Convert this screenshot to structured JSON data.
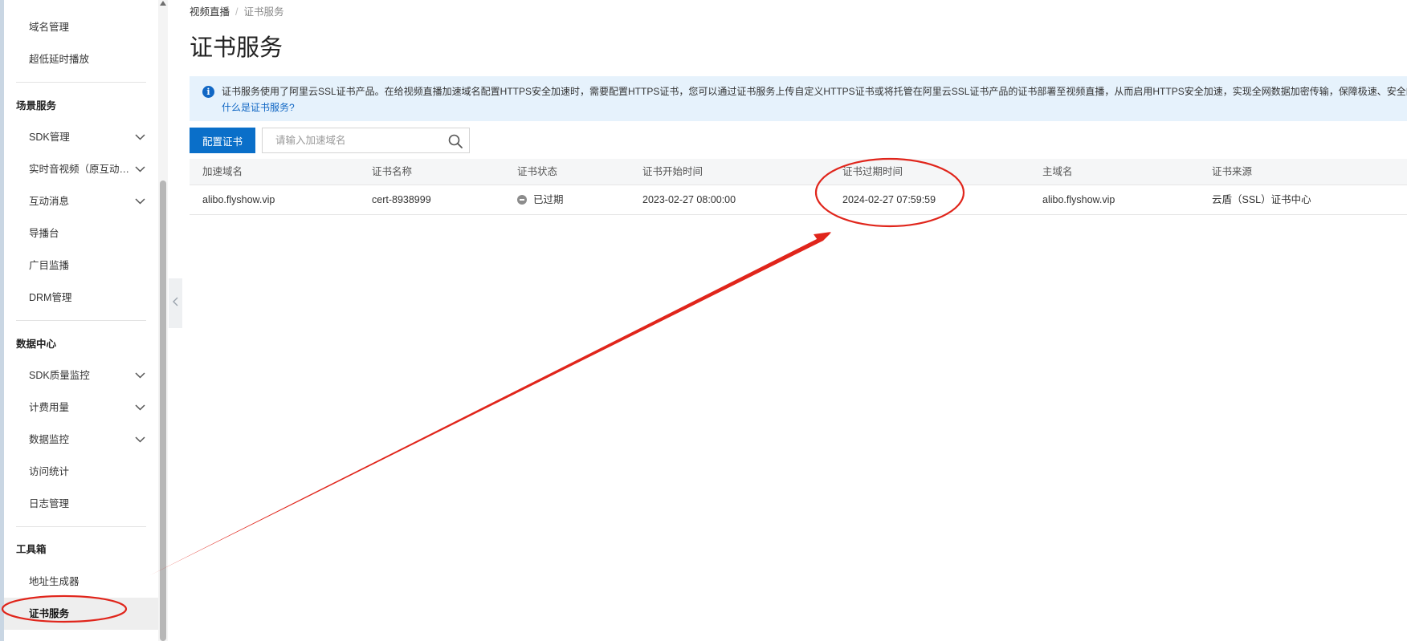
{
  "sidebar": {
    "items": [
      {
        "label": "域名管理"
      },
      {
        "label": "超低延时播放"
      },
      {
        "label": "SDK管理"
      },
      {
        "label": "实时音视频（原互动直播）"
      },
      {
        "label": "互动消息"
      },
      {
        "label": "导播台"
      },
      {
        "label": "广目监播"
      },
      {
        "label": "DRM管理"
      },
      {
        "label": "SDK质量监控"
      },
      {
        "label": "计费用量"
      },
      {
        "label": "数据监控"
      },
      {
        "label": "访问统计"
      },
      {
        "label": "日志管理"
      },
      {
        "label": "地址生成器"
      },
      {
        "label": "证书服务"
      }
    ],
    "groups": {
      "scene": "场景服务",
      "data": "数据中心",
      "tools": "工具箱"
    }
  },
  "breadcrumb": {
    "parent": "视频直播",
    "separator": "/",
    "current": "证书服务"
  },
  "page_title": "证书服务",
  "notice": {
    "text": "证书服务使用了阿里云SSL证书产品。在给视频直播加速域名配置HTTPS安全加速时，需要配置HTTPS证书，您可以通过证书服务上传自定义HTTPS证书或将托管在阿里云SSL证书产品的证书部署至视频直播，从而启用HTTPS安全加速，实现全网数据加密传输，保障极速、安全的网",
    "link": "什么是证书服务?"
  },
  "toolbar": {
    "configure_label": "配置证书",
    "search_placeholder": "请输入加速域名"
  },
  "table": {
    "columns": [
      "加速域名",
      "证书名称",
      "证书状态",
      "证书开始时间",
      "证书过期时间",
      "主域名",
      "证书来源"
    ],
    "rows": [
      {
        "domain": "alibo.flyshow.vip",
        "cert_name": "cert-8938999",
        "status": "已过期",
        "start_time": "2023-02-27 08:00:00",
        "expire_time": "2024-02-27 07:59:59",
        "main_domain": "alibo.flyshow.vip",
        "source": "云盾（SSL）证书中心"
      }
    ]
  },
  "colors": {
    "primary": "#0a6fc9",
    "notice_bg": "#e6f2fc",
    "annotation": "#e0251b",
    "active_item_bg": "#eeeeee"
  },
  "icons": {
    "notice": "info-icon",
    "search": "search-icon",
    "expand": "chevron-down-icon",
    "collapse": "chevron-left-icon",
    "status": "expired-status-icon"
  }
}
